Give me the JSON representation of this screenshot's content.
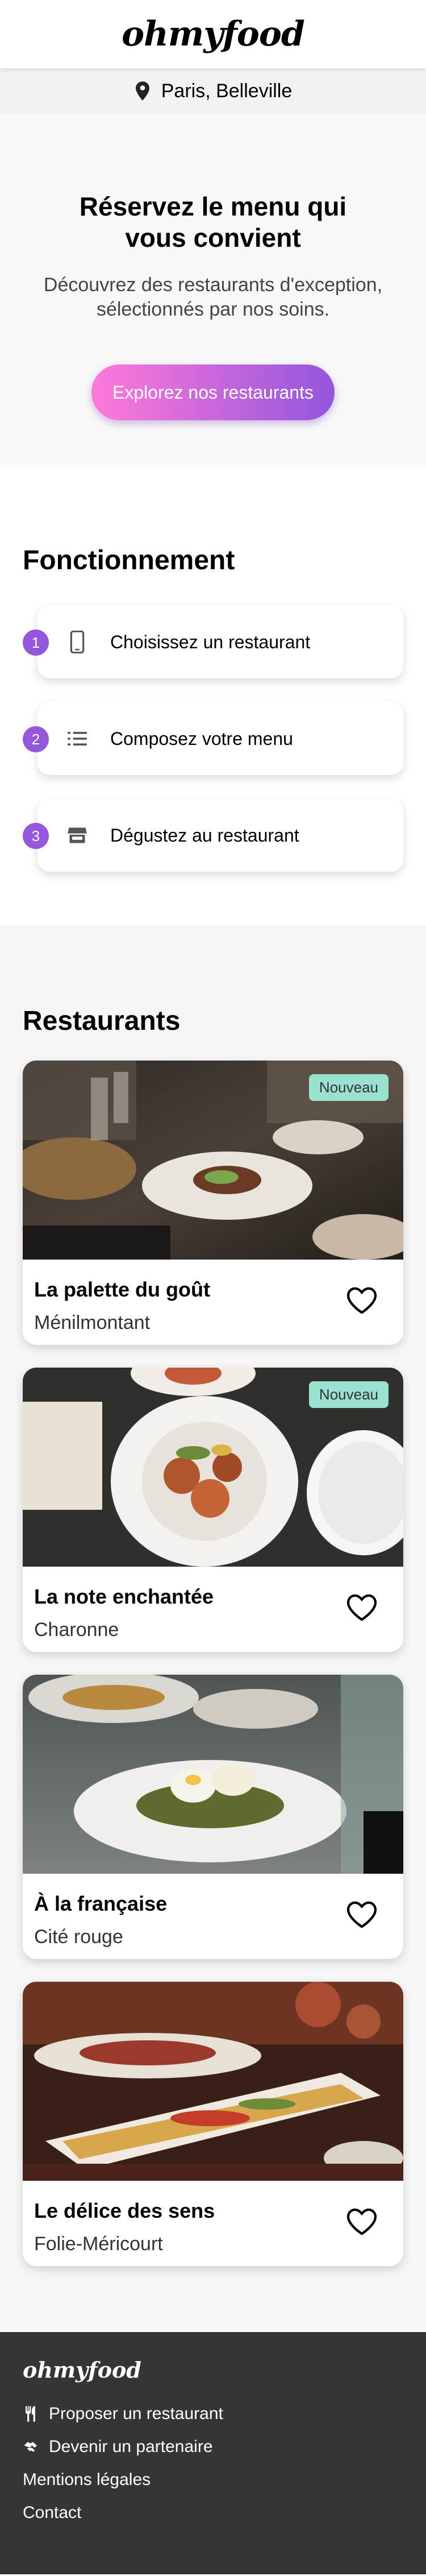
{
  "header": {
    "logo": "ohmyfood"
  },
  "location": {
    "icon": "map-pin-icon",
    "text": "Paris, Belleville"
  },
  "hero": {
    "title": "Réservez le menu qui vous convient",
    "subtitle": "Découvrez des restaurants d'exception, sélectionnés par nos soins.",
    "cta": "Explorez nos restaurants",
    "cta_gradient": [
      "#ff79da",
      "#9356dc"
    ]
  },
  "how": {
    "title": "Fonctionnement",
    "steps": [
      {
        "num": "1",
        "icon": "mobile-phone-icon",
        "label": "Choisissez un restaurant"
      },
      {
        "num": "2",
        "icon": "list-icon",
        "label": "Composez votre menu"
      },
      {
        "num": "3",
        "icon": "store-icon",
        "label": "Dégustez au restaurant"
      }
    ],
    "accent": "#9356dc"
  },
  "restaurants": {
    "title": "Restaurants",
    "items": [
      {
        "name": "La palette du goût",
        "area": "Ménilmontant",
        "badge": "Nouveau",
        "favorite": false
      },
      {
        "name": "La note enchantée",
        "area": "Charonne",
        "badge": "Nouveau",
        "favorite": false
      },
      {
        "name": "À la française",
        "area": "Cité rouge",
        "badge": "",
        "favorite": false
      },
      {
        "name": "Le délice des sens",
        "area": "Folie-Méricourt",
        "badge": "",
        "favorite": false
      }
    ],
    "badge_color": "#99e2d0"
  },
  "footer": {
    "logo": "ohmyfood",
    "links": [
      {
        "label": "Proposer un restaurant",
        "icon": "utensils-icon"
      },
      {
        "label": "Devenir un partenaire",
        "icon": "handshake-icon"
      },
      {
        "label": "Mentions légales",
        "icon": ""
      },
      {
        "label": "Contact",
        "icon": ""
      }
    ],
    "background": "#353535"
  }
}
